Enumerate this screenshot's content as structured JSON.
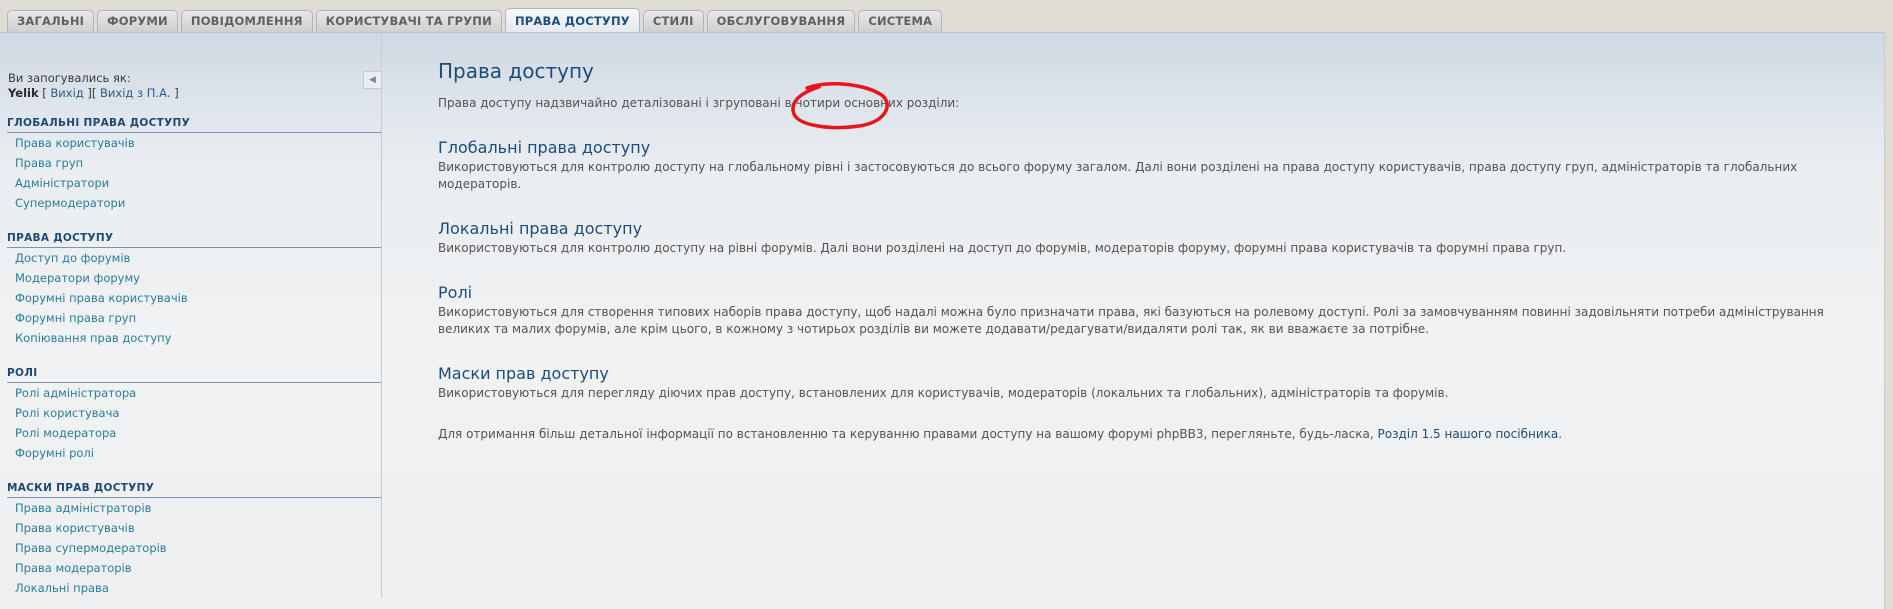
{
  "tabs": [
    {
      "label": "ЗАГАЛЬНІ",
      "active": false
    },
    {
      "label": "ФОРУМИ",
      "active": false
    },
    {
      "label": "ПОВІДОМЛЕННЯ",
      "active": false
    },
    {
      "label": "КОРИСТУВАЧІ ТА ГРУПИ",
      "active": false
    },
    {
      "label": "ПРАВА ДОСТУПУ",
      "active": true
    },
    {
      "label": "СТИЛІ",
      "active": false
    },
    {
      "label": "ОБСЛУГОВУВАННЯ",
      "active": false
    },
    {
      "label": "СИСТЕМА",
      "active": false
    }
  ],
  "sidebar": {
    "logged_in_label": "Ви запогувались як:",
    "username": "Yelik",
    "logout": "Вихід",
    "logout_acp": "Вихід з П.А.",
    "groups": [
      {
        "title": "ГЛОБАЛЬНІ ПРАВА ДОСТУПУ",
        "items": [
          "Права користувачів",
          "Права груп",
          "Адміністратори",
          "Супермодератори"
        ]
      },
      {
        "title": "ПРАВА ДОСТУПУ",
        "items": [
          "Доступ до форумів",
          "Модератори форуму",
          "Форумні права користувачів",
          "Форумні права груп",
          "Копіювання прав доступу"
        ]
      },
      {
        "title": "РОЛІ",
        "items": [
          "Ролі адміністратора",
          "Ролі користувача",
          "Ролі модератора",
          "Форумні ролі"
        ]
      },
      {
        "title": "МАСКИ ПРАВ ДОСТУПУ",
        "items": [
          "Права адміністраторів",
          "Права користувачів",
          "Права супермодераторів",
          "Права модераторів",
          "Локальні права"
        ]
      }
    ]
  },
  "main": {
    "title": "Права доступу",
    "intro": "Права доступу надзвичайно деталізовані і згруповані в чотири основних розділи:",
    "sections": [
      {
        "title": "Глобальні права доступу",
        "text": "Використовуються для контролю доступу на глобальному рівні і застосовуються до всього форуму загалом. Далі вони розділені на права доступу користувачів, права доступу груп, адміністраторів та глобальних модераторів."
      },
      {
        "title": "Локальні права доступу",
        "text": "Використовуються для контролю доступу на рівні форумів. Далі вони розділені на доступ до форумів, модераторів форуму, форумні права користувачів та форумні права груп."
      },
      {
        "title": "Ролі",
        "text": "Використовуються для створення типових наборів права доступу, щоб надалі можна було призначати права, які базуються на ролевому доступі. Ролі за замовчуванням повинні задовільняти потреби адміністрування великих та малих форумів, але крім цього, в кожному з чотирьох розділів ви можете додавати/редагувати/видаляти ролі так, як ви вважаєте за потрібне."
      },
      {
        "title": "Маски прав доступу",
        "text": "Використовуються для перегляду діючих прав доступу, встановлених для користувачів, модераторів (локальних та глобальних), адміністраторів та форумів."
      }
    ],
    "footer_text": "Для отримання більш детальної інформації по встановленню та керуванню правами доступу на вашому форумі phpBB3, перегляньте, будь-ласка,",
    "footer_link": "Розділ 1.5 нашого посібника",
    "footer_end": "."
  },
  "colors": {
    "accent": "#1c4c78",
    "link": "#2a7d9a",
    "annotation": "#e8151b"
  }
}
